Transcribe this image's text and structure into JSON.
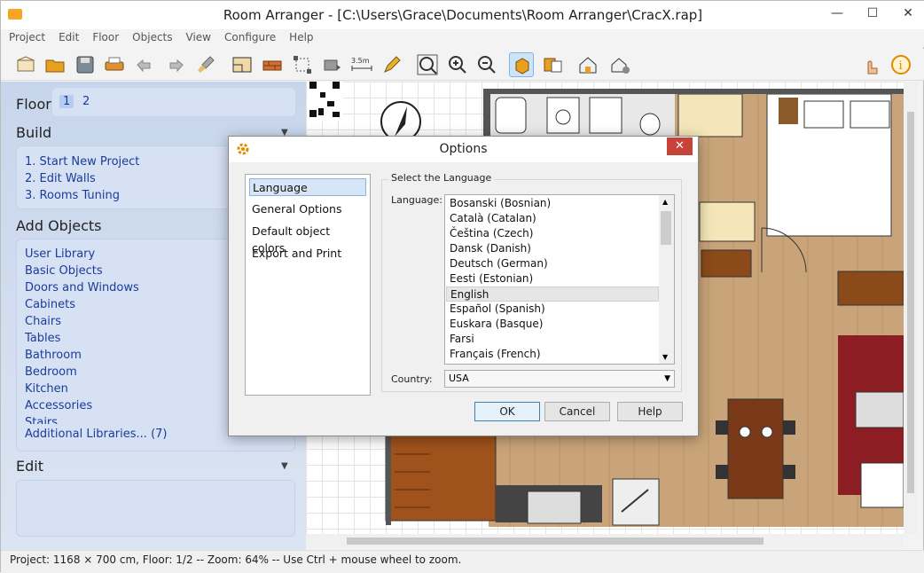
{
  "window": {
    "title": "Room Arranger - [C:\\Users\\Grace\\Documents\\Room Arranger\\CracX.rap]"
  },
  "menu": [
    "Project",
    "Edit",
    "Floor",
    "Objects",
    "View",
    "Configure",
    "Help"
  ],
  "left": {
    "floor_label": "Floor",
    "floors": [
      "1",
      "2"
    ],
    "build_title": "Build",
    "build_items": [
      "1. Start New Project",
      "2. Edit Walls",
      "3. Rooms Tuning"
    ],
    "add_title": "Add Objects",
    "add_items": [
      "User Library",
      "Basic Objects",
      "Doors and Windows",
      "Cabinets",
      "Chairs",
      "Tables",
      "Bathroom",
      "Bedroom",
      "Kitchen",
      "Accessories",
      "Stairs",
      "Additional Libraries... (7)"
    ],
    "edit_title": "Edit"
  },
  "toolbar": {
    "scale_label": "3.5m"
  },
  "status": "Project: 1168 × 700 cm, Floor: 1/2 -- Zoom: 64% -- Use Ctrl + mouse wheel to zoom.",
  "dialog": {
    "title": "Options",
    "categories": [
      "Language",
      "General Options",
      "Default object colors",
      "Export and Print"
    ],
    "group_title": "Select the Language",
    "language_label": "Language:",
    "languages": [
      "Bosanski (Bosnian)",
      "Català (Catalan)",
      "Čeština (Czech)",
      "Dansk (Danish)",
      "Deutsch (German)",
      "Eesti (Estonian)",
      "English",
      "Español (Spanish)",
      "Euskara (Basque)",
      "Farsi",
      "Français (French)"
    ],
    "selected_language": "English",
    "country_label": "Country:",
    "country_value": "USA",
    "ok": "OK",
    "cancel": "Cancel",
    "help": "Help"
  },
  "colors": {
    "accent": "#1a3c9a",
    "panel": "#d7e1f4",
    "floor_wood": "#c9a47a",
    "close_red": "#c7433a"
  }
}
